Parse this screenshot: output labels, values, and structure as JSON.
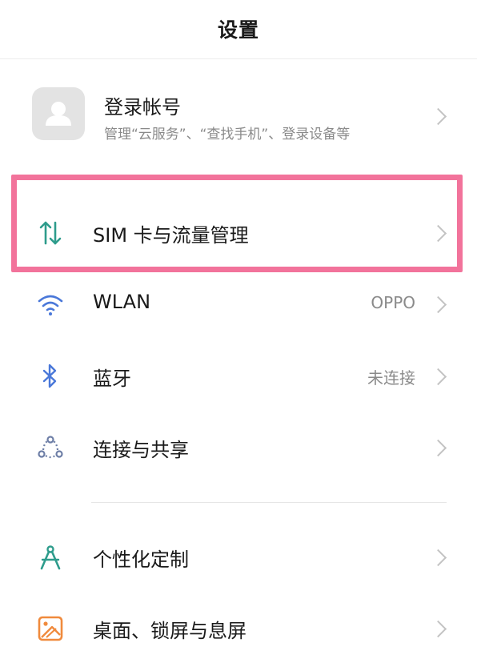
{
  "header": {
    "title": "设置"
  },
  "account": {
    "name": "登录帐号",
    "subtitle": "管理“云服务”、“查找手机”、登录设备等"
  },
  "rows": [
    {
      "label": "SIM 卡与流量管理",
      "value": "",
      "icon": "sim-data-icon",
      "highlighted": true
    },
    {
      "label": "WLAN",
      "value": "OPPO",
      "icon": "wifi-icon"
    },
    {
      "label": "蓝牙",
      "value": "未连接",
      "icon": "bluetooth-icon"
    },
    {
      "label": "连接与共享",
      "value": "",
      "icon": "connection-share-icon"
    },
    {
      "label": "个性化定制",
      "value": "",
      "icon": "personalize-icon"
    },
    {
      "label": "桌面、锁屏与息屏",
      "value": "",
      "icon": "home-lock-screen-icon"
    }
  ],
  "colors": {
    "highlight": "#f2739b",
    "sim_icon": "#2e9c8c",
    "wifi_icon": "#4a78d9",
    "bluetooth_icon": "#4a78d9",
    "connection_icon": "#6d7ea6",
    "personalize_icon": "#2e9c8c",
    "home_icon": "#f08a3c"
  }
}
